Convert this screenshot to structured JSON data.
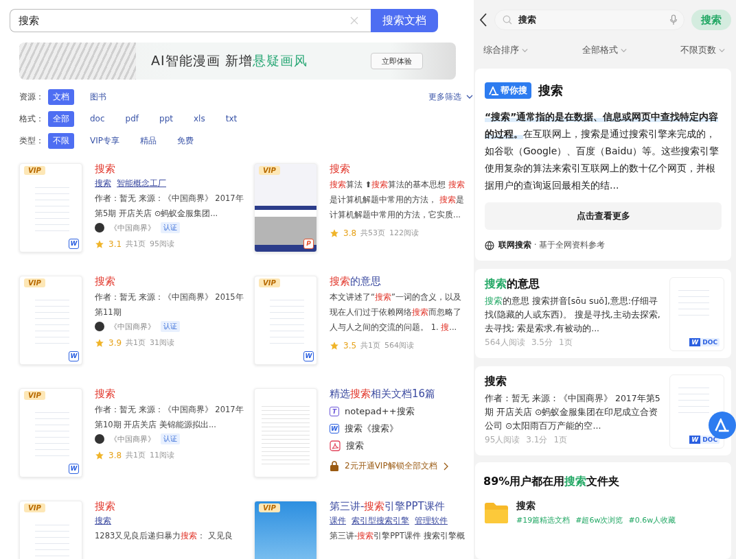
{
  "search": {
    "value": "搜索",
    "button": "搜索文档"
  },
  "banner": {
    "text": "AI智能漫画 新增**悬疑画风**",
    "button": "立即体验"
  },
  "filters": [
    {
      "label": "资源：",
      "options": [
        {
          "label": "文档",
          "selected": true
        },
        {
          "label": "图书",
          "selected": false
        }
      ]
    },
    {
      "label": "格式：",
      "options": [
        {
          "label": "全部",
          "selected": true
        },
        {
          "label": "doc",
          "selected": false
        },
        {
          "label": "pdf",
          "selected": false
        },
        {
          "label": "ppt",
          "selected": false
        },
        {
          "label": "xls",
          "selected": false
        },
        {
          "label": "txt",
          "selected": false
        }
      ]
    },
    {
      "label": "类型：",
      "options": [
        {
          "label": "不限",
          "selected": true
        },
        {
          "label": "VIP专享",
          "selected": false
        },
        {
          "label": "精品",
          "selected": false
        },
        {
          "label": "免费",
          "selected": false
        }
      ]
    }
  ],
  "more_filters": "更多筛选",
  "results": [
    {
      "kind": "doc",
      "thumb": {
        "kind": "page",
        "vip_badge": "VIP",
        "file_badge": {
          "kind": "word",
          "label": "W"
        }
      },
      "title": "**搜索**",
      "tags": [
        "搜索",
        "智能概念工厂"
      ],
      "snippet": "作者：暂无 来源：《中国商界》 2017年第5期 开店关店 ⊙蚂蚁金服集团...",
      "source": "《中国商界》",
      "verified": "认证",
      "score": "3.1",
      "pages": "共1页",
      "reads": "95阅读"
    },
    {
      "kind": "doc",
      "thumb": {
        "kind": "slides",
        "vip_badge": "VIP",
        "file_badge": {
          "kind": "ppt",
          "label": "P"
        }
      },
      "title": "**搜索**",
      "snippet": "**搜索**算法 ⬆**搜索**算法的基本思想 **搜索**是计算机解题中常用的方法， **搜索**是计算机解题中常用的方法，它实质...",
      "score": "3.8",
      "pages": "共53页",
      "reads": "122阅读"
    },
    {
      "kind": "doc",
      "thumb": {
        "kind": "page",
        "vip_badge": "VIP",
        "file_badge": {
          "kind": "word",
          "label": "W"
        }
      },
      "title": "**搜索**",
      "snippet": "作者：暂无 来源：《中国商界》 2015年第11期",
      "source": "《中国商界》",
      "verified": "认证",
      "score": "3.9",
      "pages": "共1页",
      "reads": "31阅读"
    },
    {
      "kind": "doc",
      "thumb": {
        "kind": "page",
        "vip_badge": "VIP",
        "file_badge": {
          "kind": "word",
          "label": "W"
        }
      },
      "title": "**搜索**的意思",
      "snippet": "本文讲述了“**搜索**”一词的含义，以及现在人们过于依赖网络**搜索**而忽略了人与人之间的交流的问题。 1. **搜**...",
      "score": "3.5",
      "pages": "共1页",
      "reads": "564阅读"
    },
    {
      "kind": "doc",
      "thumb": {
        "kind": "page",
        "vip_badge": "VIP",
        "file_badge": {
          "kind": "word",
          "label": "W"
        }
      },
      "title": "**搜索**",
      "snippet": "作者：暂无 来源：《中国商界》 2017年第10期 开店关店 美锦能源拟出...",
      "source": "《中国商界》",
      "verified": "认证",
      "score": "3.8",
      "pages": "共1页",
      "reads": "11阅读"
    },
    {
      "kind": "collection",
      "thumb": {
        "kind": "stack"
      },
      "title": "精选**搜索**相关文档16篇",
      "items": [
        {
          "kind": "txt",
          "icon": "T",
          "label": "notepad++搜索"
        },
        {
          "kind": "word",
          "icon": "W",
          "label": "搜索《搜索》"
        },
        {
          "kind": "pdf",
          "label": "搜索"
        }
      ],
      "unlock": "2元开通VIP解锁全部文档"
    },
    {
      "kind": "doc",
      "thumb": {
        "kind": "page",
        "vip_badge": "VIP"
      },
      "title": "**搜索**",
      "tags": [
        "搜索"
      ],
      "snippet": "1283又见良后递归暴力**搜索**： 又见良"
    },
    {
      "kind": "doc",
      "thumb": {
        "kind": "cover",
        "vip_badge": "VIP"
      },
      "title": "第三讲-**搜索**引擎PPT课件",
      "tags": [
        "课件",
        "索引型搜索引擎",
        "管理软件"
      ],
      "snippet": "第三讲-**搜索**引擎PPT课件 搜索引擎概"
    }
  ],
  "mobile": {
    "search": {
      "value": "搜索",
      "button": "搜索"
    },
    "sort_options": [
      "综合排序",
      "全部格式",
      "不限页数"
    ],
    "ai_card": {
      "badge": "帮你搜",
      "title": "搜索",
      "answer": "**“搜索”通常指的是在数据、信息或网页中查找特定内容的过程。**在互联网上，搜索是通过搜索引擎来完成的，如谷歌（Google）、百度（Baidu）等。这些搜索引擎使用复杂的算法来索引互联网上的数十亿个网页，并根据用户的查询返回最相关的结...",
      "more_button": "点击查看更多",
      "source": "**联网搜索** · 基于全网资料参考"
    },
    "doc_cards": [
      {
        "title": "**搜索**的意思",
        "snippet": "**搜索**的意思 搜索拼音[sōu suǒ],意思:仔细寻找(隐藏的人或东西)。 搜是寻找,主动去探索,去寻找; 索是索求,有被动的...",
        "reads": "564人阅读",
        "score": "3.5分",
        "pages": "1页",
        "badge_icon": "W",
        "badge": "DOC"
      },
      {
        "title": "搜索",
        "snippet": "作者：暂无 来源：《中国商界》 2017年第5期 开店关店 ⊙蚂蚁金服集团在印尼成立合资公司 ⊙太阳雨百万产能的空...",
        "reads": "95人阅读",
        "score": "3.1分",
        "pages": "1页",
        "badge_icon": "W",
        "badge": "DOC"
      }
    ],
    "folder_card": {
      "title": "89%用户都在用**搜索**文件夹",
      "name": "搜索",
      "tags": [
        "#19篇精选文档",
        "#超6w次浏览",
        "#0.6w人收藏"
      ]
    }
  }
}
